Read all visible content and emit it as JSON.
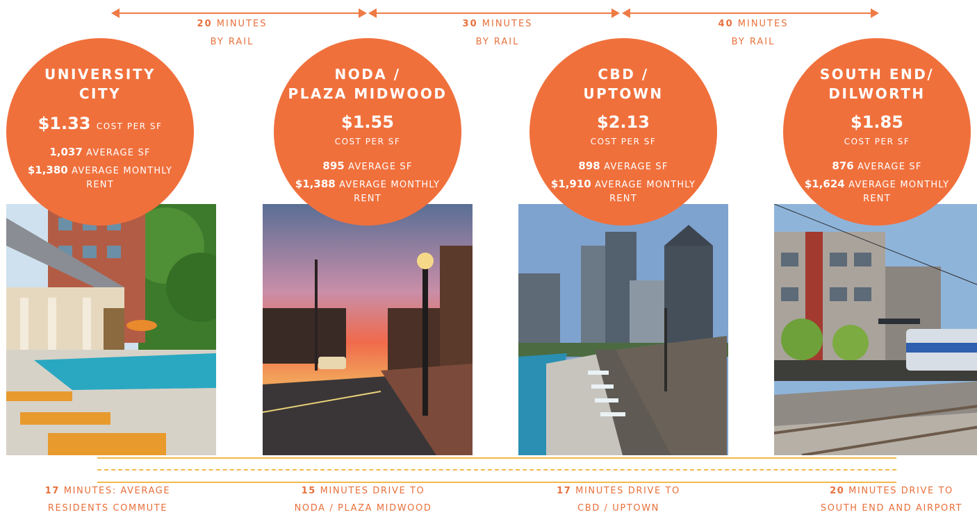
{
  "rail_segments": [
    {
      "number": "20",
      "unit": "MINUTES",
      "mode": "BY RAIL"
    },
    {
      "number": "30",
      "unit": "MINUTES",
      "mode": "BY RAIL"
    },
    {
      "number": "40",
      "unit": "MINUTES",
      "mode": "BY RAIL"
    }
  ],
  "neighborhoods": [
    {
      "name_line1": "UNIVERSITY",
      "name_line2": "CITY",
      "cost": "$1.33",
      "cost_label": "COST PER SF",
      "avg_sf": "1,037",
      "avg_sf_label": "AVERAGE SF",
      "rent": "$1,380",
      "rent_label": "AVERAGE MONTHLY RENT"
    },
    {
      "name_line1": "NODA /",
      "name_line2": "PLAZA MIDWOOD",
      "cost": "$1.55",
      "cost_label": "COST PER SF",
      "avg_sf": "895",
      "avg_sf_label": "AVERAGE SF",
      "rent": "$1,388",
      "rent_label": "AVERAGE MONTHLY RENT"
    },
    {
      "name_line1": "CBD /",
      "name_line2": "UPTOWN",
      "cost": "$2.13",
      "cost_label": "COST PER SF",
      "avg_sf": "898",
      "avg_sf_label": "AVERAGE SF",
      "rent": "$1,910",
      "rent_label": "AVERAGE MONTHLY RENT"
    },
    {
      "name_line1": "SOUTH END/",
      "name_line2": "DILWORTH",
      "cost": "$1.85",
      "cost_label": "COST PER SF",
      "avg_sf": "876",
      "avg_sf_label": "AVERAGE SF",
      "rent": "$1,624",
      "rent_label": "AVERAGE MONTHLY RENT"
    }
  ],
  "drive_notes": [
    {
      "number": "17",
      "line1": "MINUTES: AVERAGE",
      "line2": "RESIDENTS COMMUTE"
    },
    {
      "number": "15",
      "line1": "MINUTES DRIVE TO",
      "line2": "NODA / PLAZA MIDWOOD"
    },
    {
      "number": "17",
      "line1": "MINUTES DRIVE TO",
      "line2": "CBD / UPTOWN"
    },
    {
      "number": "20",
      "line1": "MINUTES DRIVE TO",
      "line2": "SOUTH END AND AIRPORT"
    }
  ],
  "colors": {
    "accent": "#f0703c",
    "rule": "#f2b94a"
  },
  "photos": [
    "pool-apartment-photo",
    "street-sunset-photo",
    "rooftop-skyline-photo",
    "light-rail-train-photo"
  ]
}
